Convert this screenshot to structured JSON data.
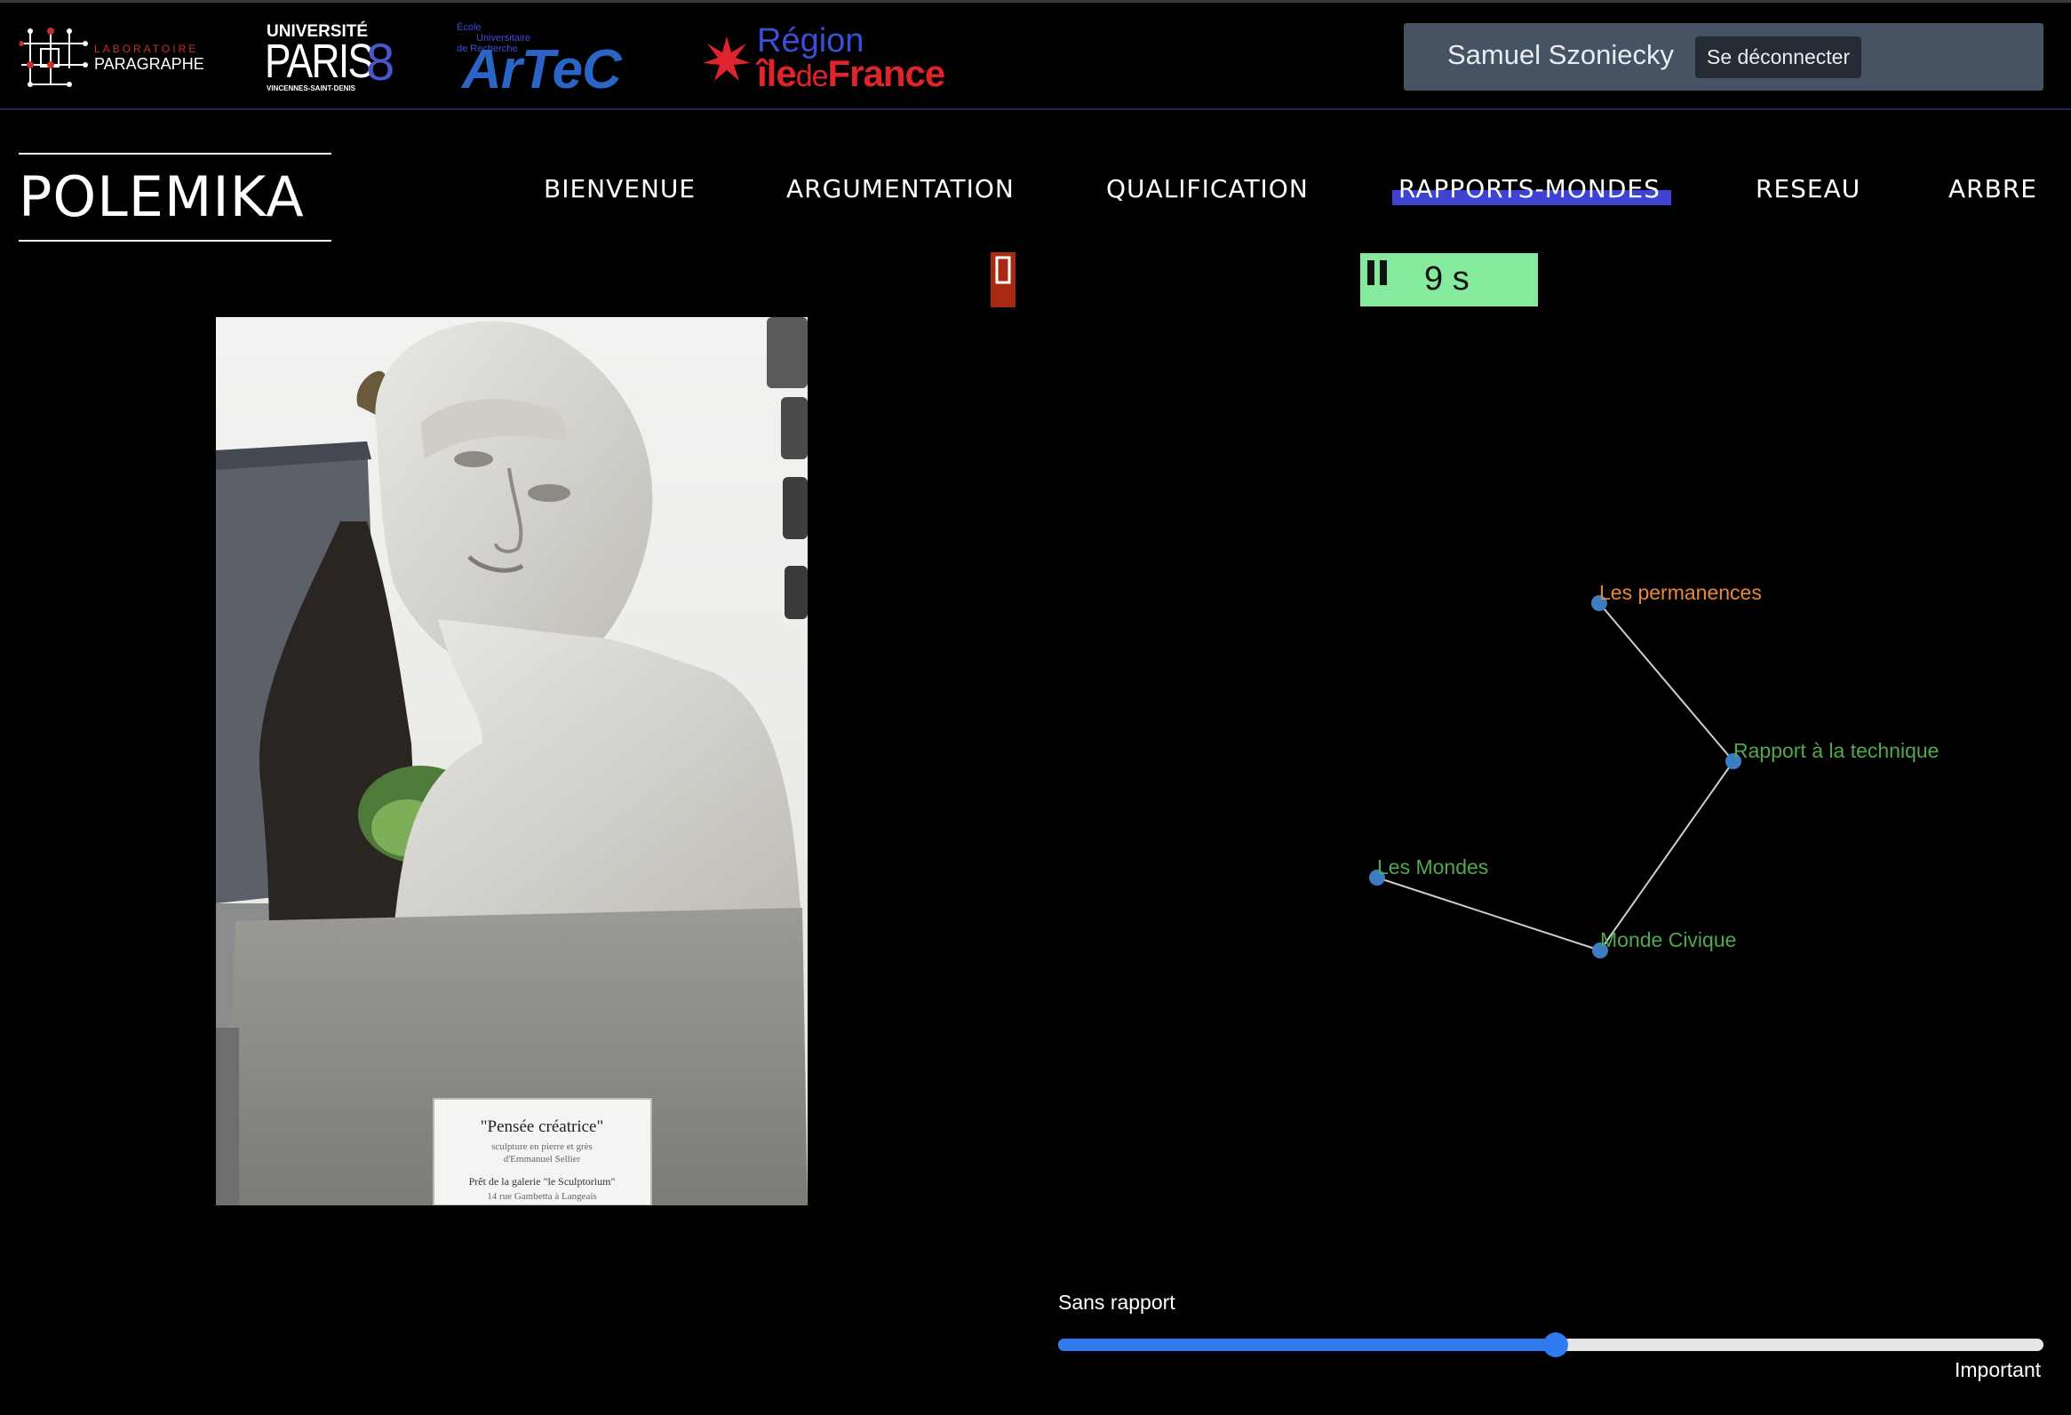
{
  "topbar": {
    "logos": {
      "paragraphe_line1": "LABORATOIRE",
      "paragraphe_line2": "PARAGRAPHE",
      "paris8_line1": "UNIVERSITÉ",
      "paris8_name": "PARIS",
      "paris8_number": "8",
      "paris8_sub": "VINCENNES-SAINT-DENIS",
      "artec_line1": "École",
      "artec_line2": "Universitaire",
      "artec_line3": "de Recherche",
      "artec_name": "ArTeC",
      "region_line1": "Région",
      "region_line2a": "île",
      "region_line2b": "de",
      "region_line2c": "France"
    },
    "user_name": "Samuel Szoniecky",
    "logout_label": "Se déconnecter"
  },
  "header": {
    "site_title": "POLEMIKA",
    "nav": [
      {
        "label": "BIENVENUE"
      },
      {
        "label": "ARGUMENTATION"
      },
      {
        "label": "QUALIFICATION"
      },
      {
        "label": "RAPPORTS-MONDES",
        "active": true
      },
      {
        "label": "RESEAU"
      },
      {
        "label": "ARBRE"
      }
    ]
  },
  "controls": {
    "timer_text": "9 s",
    "timer_icon": "pause-icon",
    "timer_color": "#86ea9c",
    "toggle_color": "#a92a12"
  },
  "image": {
    "plaque_title": "\"Pensée créatrice\"",
    "plaque_line1": "sculpture en pierre et grès",
    "plaque_line2": "d'Emmanuel Sellier",
    "plaque_line3": "Prêt de la galerie \"le Sculptorium\"",
    "plaque_line4": "14 rue Gambetta à Langeais"
  },
  "graph": {
    "node_color": "#3d7bc3",
    "link_color": "#cfcfcf",
    "nodes": [
      {
        "id": "n1",
        "label": "Les permanences",
        "color": "#e8893a"
      },
      {
        "id": "n2",
        "label": "Rapport à la technique",
        "color": "#4fa94d"
      },
      {
        "id": "n3",
        "label": "Les Mondes",
        "color": "#4fa94d"
      },
      {
        "id": "n4",
        "label": "Monde Civique",
        "color": "#4fa94d"
      }
    ],
    "links": [
      [
        "n1",
        "n2"
      ],
      [
        "n2",
        "n4"
      ],
      [
        "n3",
        "n4"
      ]
    ]
  },
  "slider": {
    "min_label": "Sans rapport",
    "max_label": "Important",
    "value": 0.505
  }
}
